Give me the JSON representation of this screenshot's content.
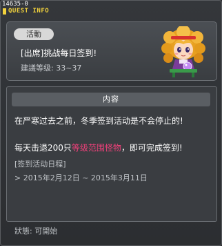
{
  "window": {
    "quest_id": "14635-0",
    "title": "QUEST INFO",
    "accent_color": "#f2d23c"
  },
  "quest": {
    "category": "活動",
    "name": "[出席]挑战每日签到!",
    "level_requirement": "建議等级: 33~37",
    "npc_icon": "npc-portrait-girl"
  },
  "content": {
    "header": "内容",
    "line1": "在严寒过去之前，冬季签到活动是不会停止的!",
    "line2_prefix": "每天击退200只",
    "line2_highlight": "等级范围怪物",
    "line2_suffix": "，即可完成签到!",
    "highlight_color": "#f0407a",
    "schedule_title": "[签到活动日程]",
    "schedule_dates": "> 2015年2月12日 ~ 2015年3月11日"
  },
  "status": {
    "label": "狀態: 可開始"
  }
}
